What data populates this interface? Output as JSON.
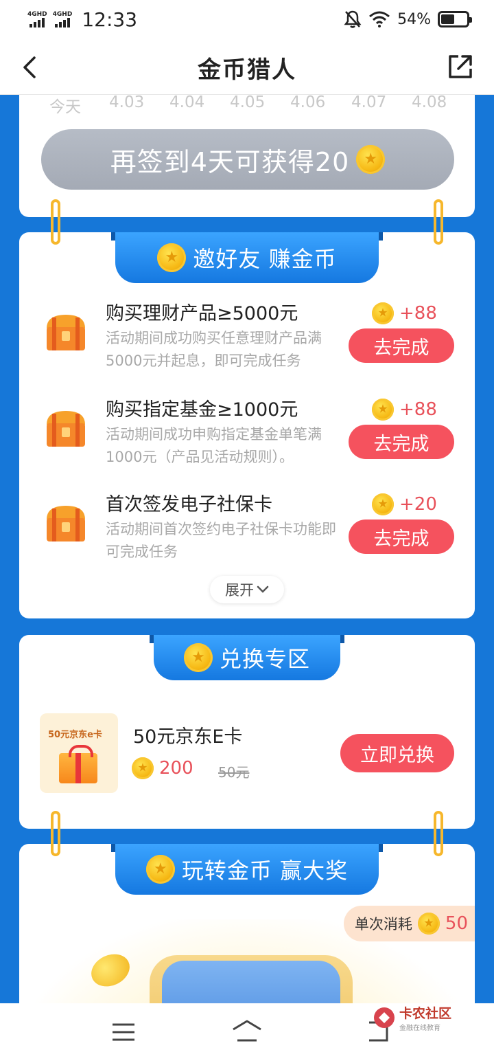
{
  "status_bar": {
    "network_1": "4GHD",
    "network_2": "4GHD",
    "time": "12:33",
    "battery_percent": "54%",
    "battery_level": 0.54,
    "icons": [
      "bell-off-icon",
      "wifi-icon",
      "battery-icon"
    ]
  },
  "header": {
    "title": "金币猎人",
    "back_icon": "chevron-left-icon",
    "share_icon": "share-icon"
  },
  "checkin": {
    "dates": [
      "今天",
      "4.03",
      "4.04",
      "4.05",
      "4.06",
      "4.07",
      "4.08"
    ],
    "button_label": "再签到4天可获得20"
  },
  "invite": {
    "title": "邀好友 赚金币",
    "tasks": [
      {
        "title": "购买理财产品≥5000元",
        "desc": "活动期间成功购买任意理财产品满5000元并起息，即可完成任务",
        "reward": "+88",
        "button": "去完成"
      },
      {
        "title": "购买指定基金≥1000元",
        "desc": "活动期间成功申购指定基金单笔满1000元（产品见活动规则）。",
        "reward": "+88",
        "button": "去完成"
      },
      {
        "title": "首次签发电子社保卡",
        "desc": "活动期间首次签约电子社保卡功能即可完成任务",
        "reward": "+20",
        "button": "去完成"
      }
    ],
    "expand_label": "展开"
  },
  "exchange": {
    "title": "兑换专区",
    "product": {
      "image_label": "50元京东e卡",
      "name": "50元京东E卡",
      "price": "200",
      "original_price": "50元",
      "button": "立即兑换"
    }
  },
  "game": {
    "title": "玩转金币 赢大奖",
    "cost_label": "单次消耗",
    "cost_value": "50"
  },
  "watermark": {
    "brand": "卡农社区",
    "slogan": "金融在线教育"
  },
  "colors": {
    "page_bg": "#1677d8",
    "accent_red": "#f5525e",
    "ribbon_blue": "#1578e0",
    "coin_gold": "#f6b814"
  }
}
